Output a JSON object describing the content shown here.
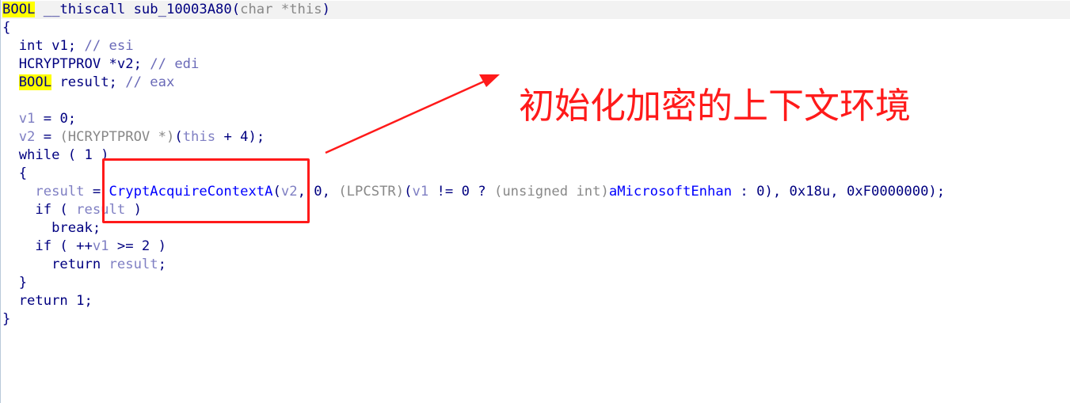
{
  "code": {
    "signature": {
      "ret_type": "BOOL",
      "callconv": " __thiscall sub_10003A80(",
      "param_type": "char *",
      "param_name": "this",
      "close": ")"
    },
    "open_brace": "{",
    "decl1": {
      "type": "  int ",
      "name": "v1",
      "sep": "; ",
      "comment": "// esi"
    },
    "decl2": {
      "type": "  HCRYPTPROV *",
      "name": "v2",
      "sep": "; ",
      "comment": "// edi"
    },
    "decl3": {
      "indent": "  ",
      "type": "BOOL",
      "rest": " result; ",
      "comment": "// eax"
    },
    "assign1": {
      "indent": "  ",
      "var": "v1",
      "rest": " = 0;"
    },
    "assign2": {
      "indent": "  ",
      "var": "v2",
      "eq": " = ",
      "cast": "(HCRYPTPROV *)",
      "open": "(",
      "this": "this",
      "rest": " + 4);"
    },
    "while_line": "  while ( 1 )",
    "inner_open": "  {",
    "call_line": {
      "indent": "    ",
      "lhs": "result",
      "eq": " = ",
      "func": "CryptAcquireContextA",
      "p1": "(",
      "v2": "v2",
      "args1": ", 0, ",
      "cast": "(LPCSTR)",
      "args2": "(",
      "v1": "v1",
      "args3": " != 0 ? ",
      "cast2": "(unsigned int)",
      "strref": "aMicrosoftEnhan",
      "args4": " : 0), 0x18u, 0xF0000000);"
    },
    "if1": {
      "pre": "    if ( ",
      "var": "result",
      "post": " )"
    },
    "break_line": "      break;",
    "if2": {
      "pre": "    if ( ++",
      "var": "v1",
      "post": " >= 2 )"
    },
    "return1": {
      "pre": "      return ",
      "var": "result",
      "post": ";"
    },
    "inner_close": "  }",
    "return2": "  return 1;",
    "close_brace": "}"
  },
  "annotation": {
    "text": "初始化加密的上下文环境",
    "color": "#ff1a1a"
  }
}
